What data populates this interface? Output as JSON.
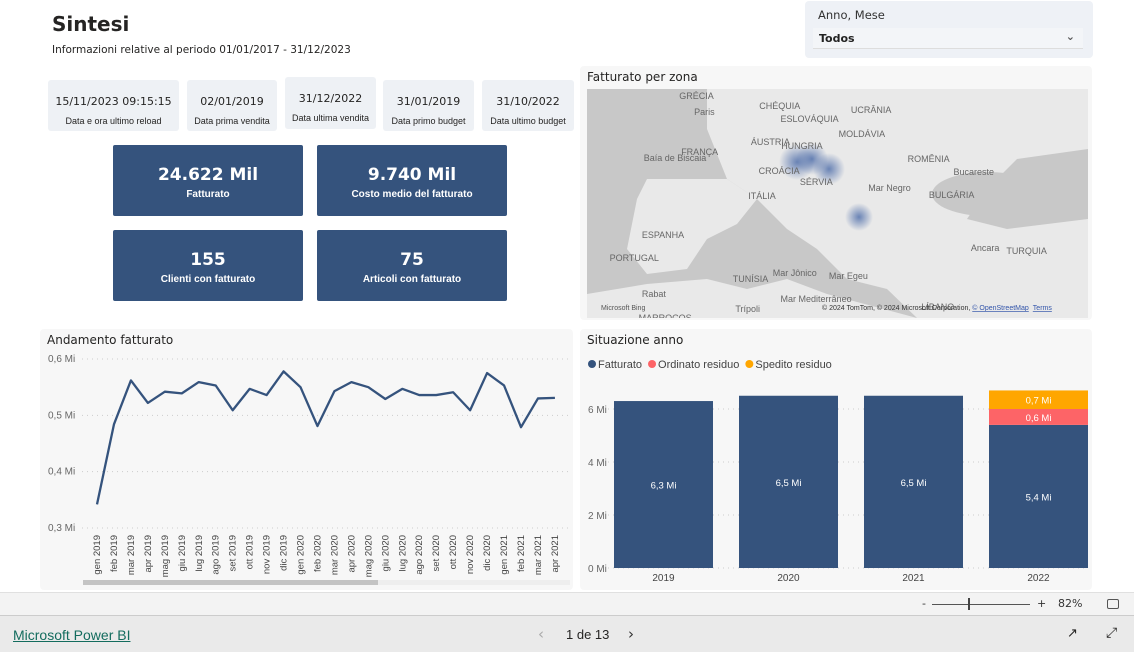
{
  "header": {
    "title": "Sintesi",
    "subtitle": "Informazioni relative al periodo 01/01/2017 - 31/12/2023"
  },
  "slicer": {
    "label": "Anno, Mese",
    "value": "Todos",
    "icon": "chevron-down-icon"
  },
  "info_cards": [
    {
      "value": "15/11/2023 09:15:15",
      "label": "Data e ora ultimo reload"
    },
    {
      "value": "02/01/2019",
      "label": "Data prima vendita"
    },
    {
      "value": "31/12/2022",
      "label": "Data ultima vendita"
    },
    {
      "value": "31/01/2019",
      "label": "Data primo budget"
    },
    {
      "value": "31/10/2022",
      "label": "Data ultimo budget"
    }
  ],
  "kpis": [
    {
      "value": "24.622 Mil",
      "label": "Fatturato"
    },
    {
      "value": "9.740 Mil",
      "label": "Costo medio del fatturato"
    },
    {
      "value": "155",
      "label": "Clienti con fatturato"
    },
    {
      "value": "75",
      "label": "Articoli con fatturato"
    }
  ],
  "map": {
    "title": "Fatturato per zona",
    "labels": [
      "Paris",
      "CHÉQUIA",
      "ESLOVÁQUIA",
      "UCRÂNIA",
      "FRANÇA",
      "ÁUSTRIA",
      "HUNGRIA",
      "MOLDÁVIA",
      "Baía de Biscaia",
      "CROÁCIA",
      "ROMÊNIA",
      "Bucareste",
      "SÉRVIA",
      "Mar Negro",
      "ITÁLIA",
      "BULGÁRIA",
      "ESPANHA",
      "GRÉCIA",
      "Ancara",
      "TURQUIA",
      "PORTUGAL",
      "Mar Jônico",
      "Mar Egeu",
      "TUNÍSIA",
      "Mar Mediterrâneo",
      "Rabat",
      "Trípoli",
      "LÍBANO",
      "MARROCOS"
    ],
    "bing": "Microsoft Bing",
    "attribution": "© 2024 TomTom, © 2024 Microsoft Corporation, ",
    "osm": "© OpenStreetMap",
    "terms": "Terms",
    "heat_color": "#4a6aa8"
  },
  "chart_data": [
    {
      "type": "line",
      "title": "Andamento fatturato",
      "color": "#35537d",
      "ylim": [
        0.3,
        0.6
      ],
      "yticks": [
        "0,3 Mi",
        "0,4 Mi",
        "0,5 Mi",
        "0,6 Mi"
      ],
      "ytick_values": [
        0.3,
        0.4,
        0.5,
        0.6
      ],
      "grid": true,
      "x": [
        "gen 2019",
        "feb 2019",
        "mar 2019",
        "apr 2019",
        "mag 2019",
        "giu 2019",
        "lug 2019",
        "ago 2019",
        "set 2019",
        "ott 2019",
        "nov 2019",
        "dic 2019",
        "gen 2020",
        "feb 2020",
        "mar 2020",
        "apr 2020",
        "mag 2020",
        "giu 2020",
        "lug 2020",
        "ago 2020",
        "set 2020",
        "ott 2020",
        "nov 2020",
        "dic 2020",
        "gen 2021",
        "feb 2021",
        "mar 2021",
        "apr 2021"
      ],
      "y": [
        0.342,
        0.484,
        0.562,
        0.522,
        0.542,
        0.539,
        0.559,
        0.553,
        0.509,
        0.547,
        0.536,
        0.578,
        0.55,
        0.481,
        0.543,
        0.559,
        0.55,
        0.529,
        0.547,
        0.536,
        0.536,
        0.541,
        0.509,
        0.575,
        0.553,
        0.479,
        0.53,
        0.531
      ],
      "unit": "Mi"
    },
    {
      "type": "bar",
      "stacked": true,
      "title": "Situazione anno",
      "categories": [
        "2019",
        "2020",
        "2021",
        "2022"
      ],
      "ylim": [
        0,
        6.7
      ],
      "yticks": [
        "0 Mi",
        "2 Mi",
        "4 Mi",
        "6 Mi"
      ],
      "ytick_values": [
        0,
        2,
        4,
        6
      ],
      "legend_position": "top-left",
      "grid": true,
      "series": [
        {
          "name": "Fatturato",
          "color": "#35537d",
          "values": [
            6.3,
            6.5,
            6.5,
            5.4
          ],
          "labels": [
            "6,3 Mi",
            "6,5 Mi",
            "6,5 Mi",
            "5,4 Mi"
          ]
        },
        {
          "name": "Ordinato residuo",
          "color": "#fd6467",
          "values": [
            0,
            0,
            0,
            0.6
          ],
          "labels": [
            "",
            "",
            "",
            "0,6 Mi"
          ]
        },
        {
          "name": "Spedito residuo",
          "color": "#ffa600",
          "values": [
            0,
            0,
            0,
            0.7
          ],
          "labels": [
            "",
            "",
            "",
            "0,7 Mi"
          ]
        }
      ]
    }
  ],
  "zoom": {
    "minus": "-",
    "plus": "+",
    "level": "82%",
    "level_fraction": 0.82
  },
  "footer": {
    "brand": "Microsoft Power BI",
    "page": "1 de 13"
  }
}
